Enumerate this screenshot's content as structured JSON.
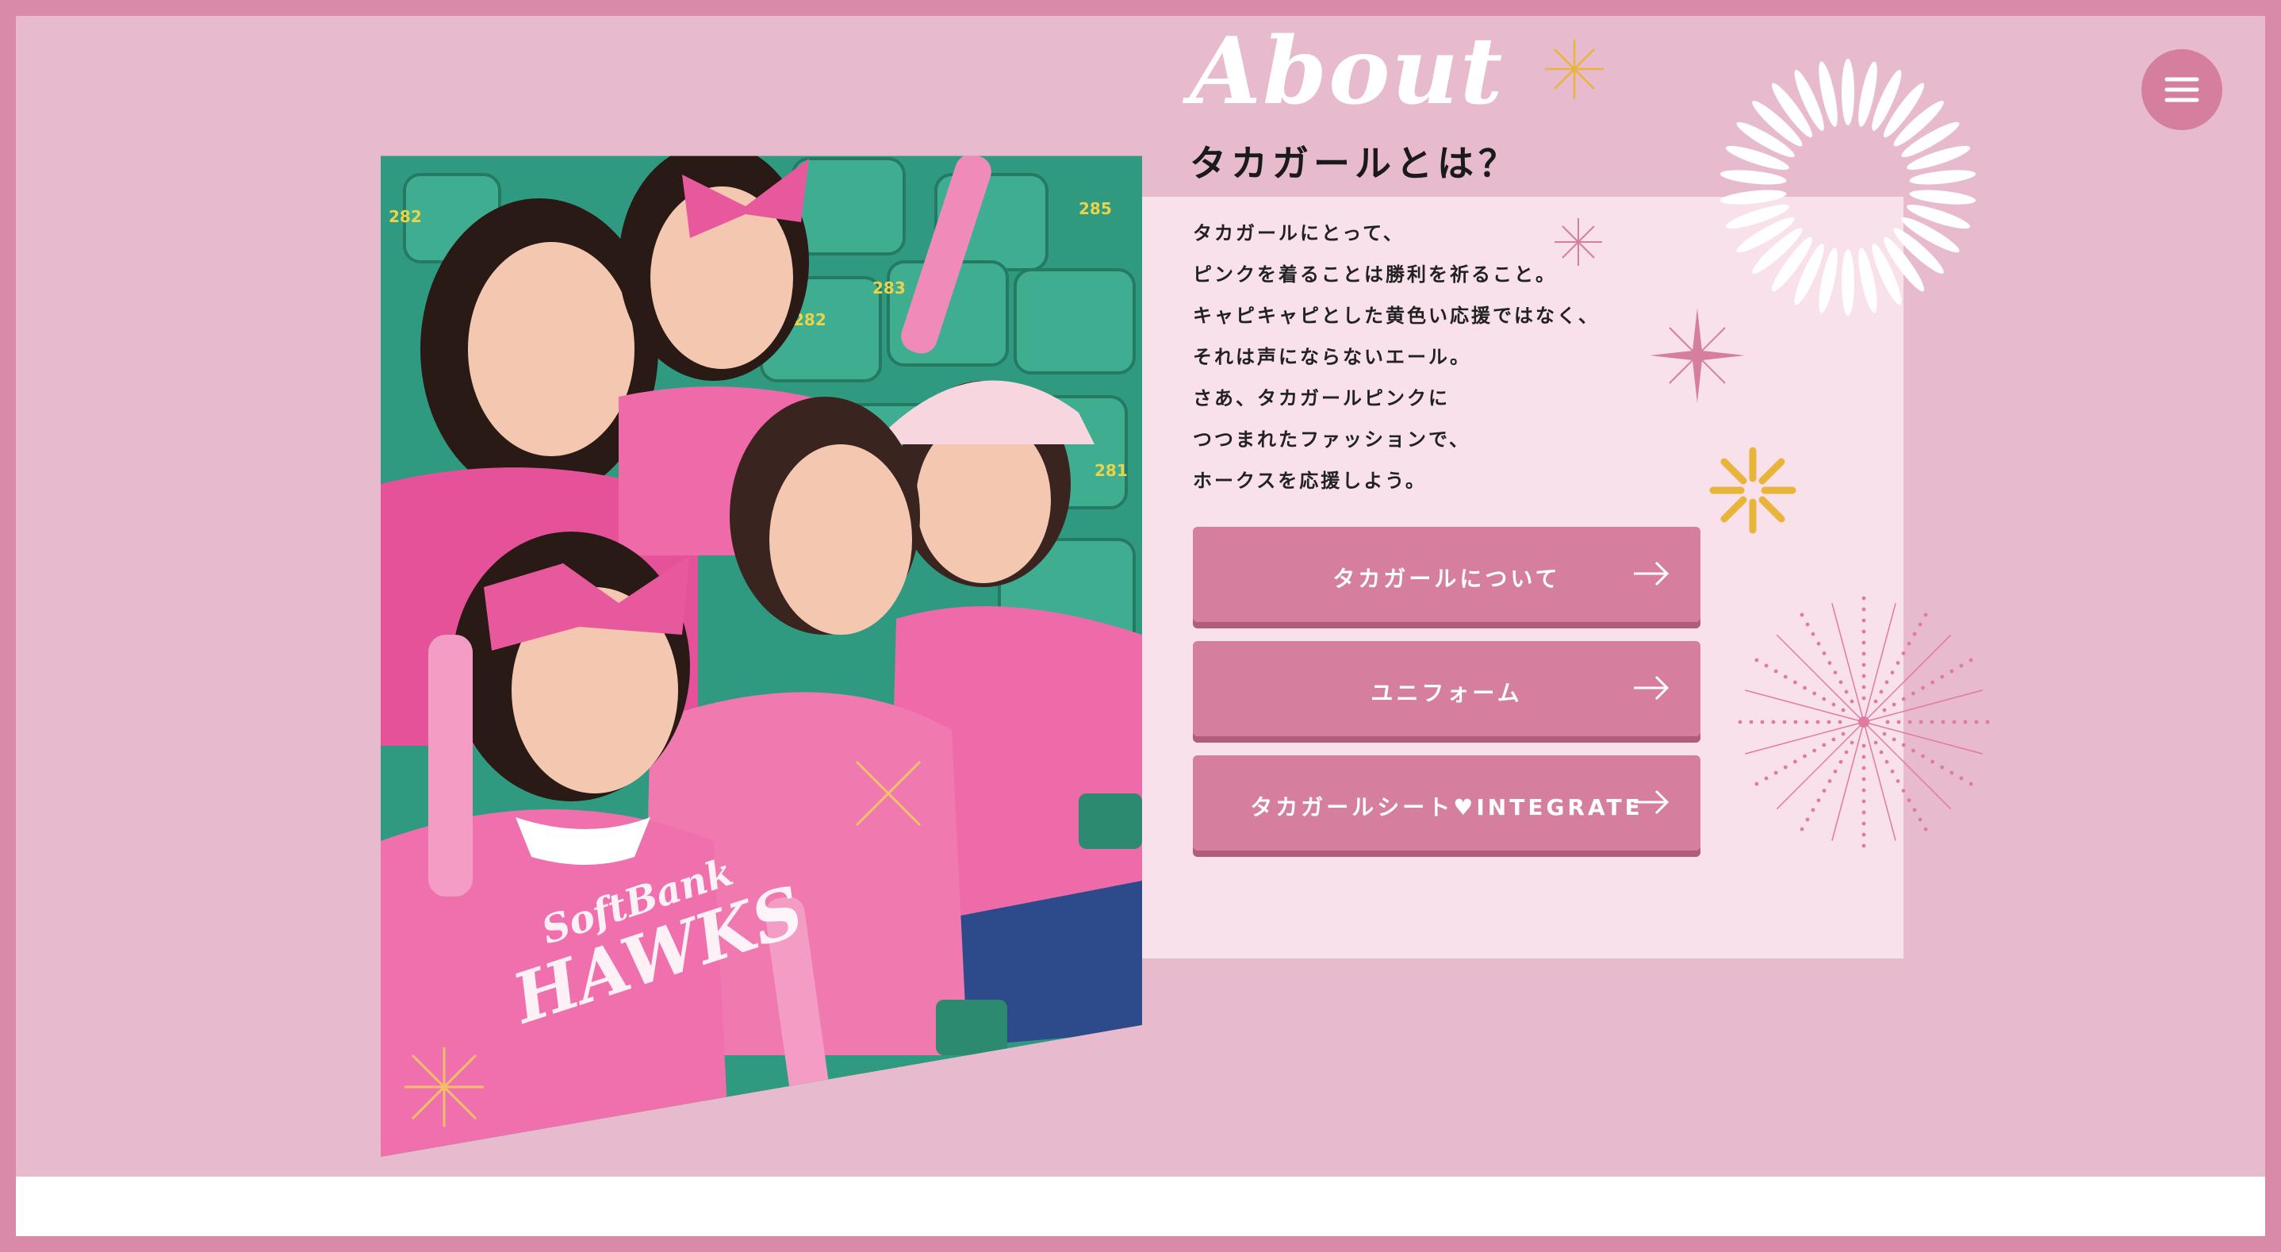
{
  "section": {
    "heading_script": "About",
    "subtitle": "タカガールとは？",
    "paragraph_lines": [
      "タカガールにとって、",
      "ピンクを着ることは勝利を祈ること。",
      "キャピキャピとした黄色い応援ではなく、",
      "それは声にならないエール。",
      "さあ、タカガールピンクに",
      "つつまれたファッションで、",
      "ホークスを応援しよう。"
    ]
  },
  "buttons": [
    {
      "label": "タカガールについて",
      "icon": "arrow-right-icon"
    },
    {
      "label": "ユニフォーム",
      "icon": "arrow-right-icon"
    },
    {
      "label": "タカガールシート♥INTEGRATE",
      "icon": "arrow-right-icon"
    }
  ],
  "menu": {
    "icon": "hamburger-menu-icon"
  },
  "photo": {
    "seat_numbers": [
      "282",
      "283",
      "285",
      "282",
      "281"
    ],
    "jersey_text": [
      "SoftBank",
      "HAWKS"
    ]
  },
  "colors": {
    "frame": "#d98aa8",
    "section_bg": "#e8bacd",
    "panel_bg": "#f9e1ec",
    "button": "#d57e9e",
    "button_shadow": "#b05c7c",
    "accent_gold": "#e8b53a",
    "seat_green": "#2f9a7f"
  }
}
